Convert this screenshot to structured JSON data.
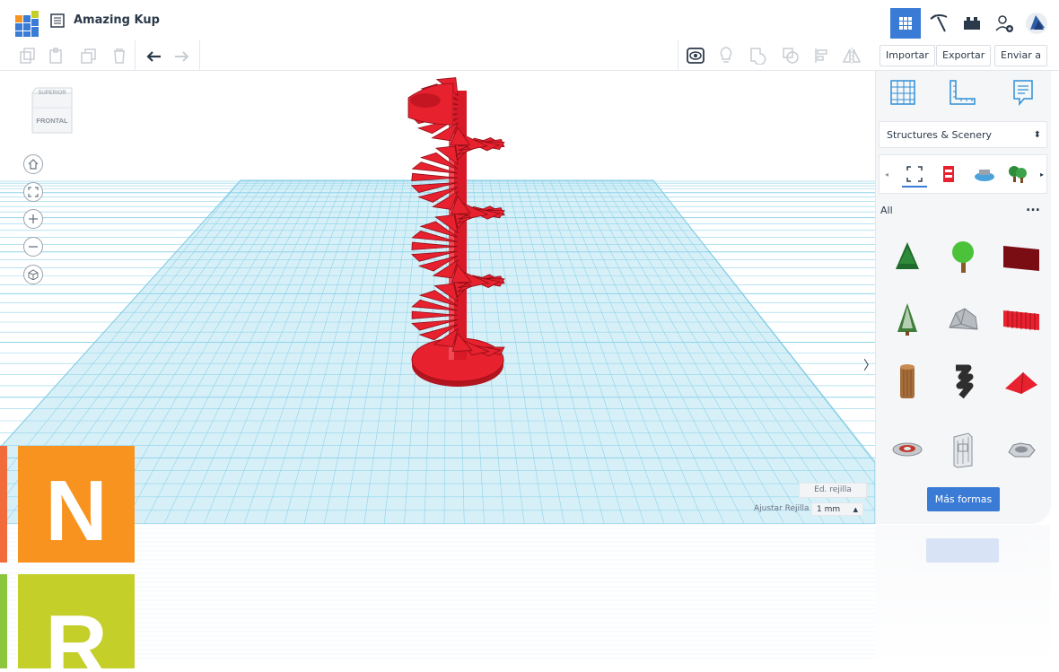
{
  "app": {
    "title": "Amazing Kup",
    "logo_letters": "TIN KER CAD"
  },
  "colors": {
    "accent": "#3a7bd5",
    "grid_blue": "#8fd3ea",
    "stair_red": "#e8212f",
    "watermark_orange": "#f7931e",
    "watermark_green": "#c4cf2a"
  },
  "topbar": {
    "icons": [
      "grid-view-icon",
      "pickaxe-icon",
      "brick-icon",
      "add-user-icon",
      "avatar-icon"
    ]
  },
  "toolbar": {
    "left_icons": [
      "copy-icon",
      "paste-icon",
      "duplicate-icon",
      "delete-icon",
      "undo-icon",
      "redo-icon"
    ],
    "right_icons": [
      "show-all-icon",
      "light-bulb-icon",
      "group-icon",
      "ungroup-icon",
      "align-icon",
      "mirror-icon"
    ],
    "import_label": "Importar",
    "export_label": "Exportar",
    "send_label": "Enviar a"
  },
  "viewcube": {
    "top_label": "SUPERIOR",
    "front_label": "FRONTAL"
  },
  "workplane": {
    "edit_grid_label": "Ed. rejilla",
    "snap_grid_label": "Ajustar Rejilla",
    "snap_grid_value": "1 mm"
  },
  "panel": {
    "tabs": [
      "workplane-icon",
      "ruler-icon",
      "notes-icon"
    ],
    "library_select": "Structures & Scenery",
    "filter_label": "All",
    "more_label": "...",
    "more_shapes_button": "Más formas",
    "shapes": [
      "pine-tree",
      "round-tree",
      "wall-panel",
      "snowy-pine",
      "rock",
      "fence",
      "tree-trunk",
      "spiral-column",
      "roof",
      "fountain",
      "tower",
      "crater"
    ]
  },
  "watermark": {
    "letter1": "N",
    "letter2": "R"
  }
}
